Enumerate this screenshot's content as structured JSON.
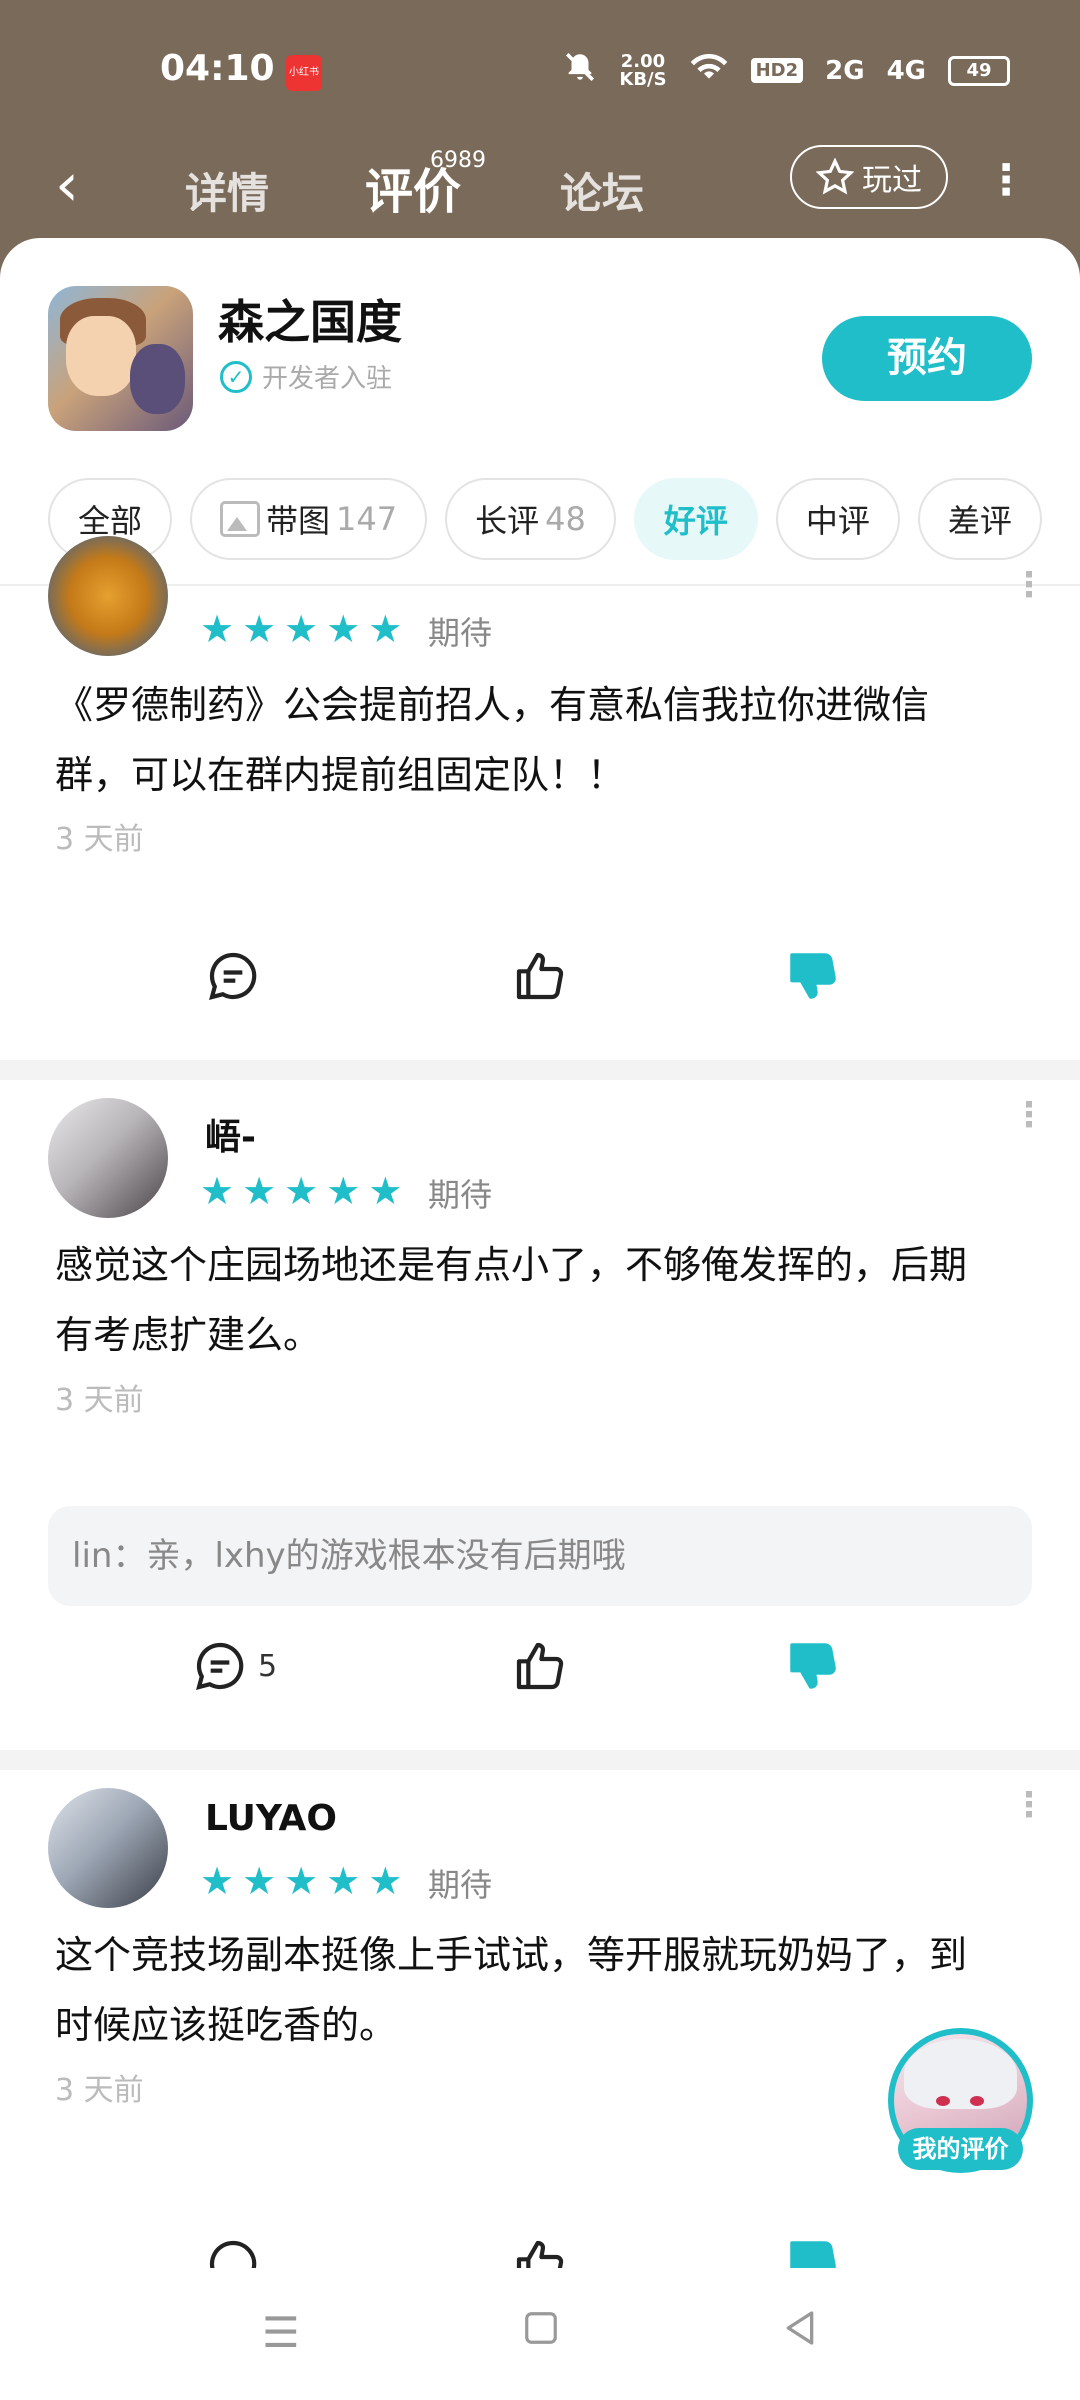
{
  "status_bar": {
    "time": "04:10",
    "app_badge": "小红书",
    "speed_value": "2.00",
    "speed_unit": "KB/S",
    "hd": "HD2",
    "net1": "2G",
    "net2": "4G",
    "battery": "49"
  },
  "header": {
    "back_icon": "back-arrow-icon",
    "tabs": [
      {
        "label": "详情"
      },
      {
        "label": "评价"
      },
      {
        "label": "论坛"
      }
    ],
    "review_count": "6989",
    "played_label": "玩过",
    "more_icon": "more-vertical-icon"
  },
  "game": {
    "title": "森之国度",
    "developer_badge": "开发者入驻",
    "reserve_label": "预约"
  },
  "filters": [
    {
      "label": "全部",
      "count": ""
    },
    {
      "label": "带图",
      "count": "147"
    },
    {
      "label": "长评",
      "count": "48"
    },
    {
      "label": "好评",
      "count": ""
    },
    {
      "label": "中评",
      "count": ""
    },
    {
      "label": "差评",
      "count": ""
    }
  ],
  "reviews": [
    {
      "username": "",
      "rating": 5,
      "tag": "期待",
      "content_line1": "《罗德制药》公会提前招人，有意私信我拉你进微信",
      "content_line2": "群，可以在群内提前组固定队！！",
      "time_ago": "3 天前",
      "reply": "",
      "comment_count": ""
    },
    {
      "username": "峿-",
      "rating": 5,
      "tag": "期待",
      "content_line1": "感觉这个庄园场地还是有点小了，不够俺发挥的，后期",
      "content_line2": "有考虑扩建么。",
      "time_ago": "3 天前",
      "reply": "lin：亲，lxhy的游戏根本没有后期哦",
      "comment_count": "5"
    },
    {
      "username": "LUYAO",
      "rating": 5,
      "tag": "期待",
      "content_line1": "这个竞技场副本挺像上手试试，等开服就玩奶妈了，到",
      "content_line2": "时候应该挺吃香的。",
      "time_ago": "3 天前",
      "reply": "",
      "comment_count": ""
    }
  ],
  "floating": {
    "label": "我的评价"
  },
  "colors": {
    "accent": "#1fbec9",
    "header_bg": "#7a6a5a"
  }
}
